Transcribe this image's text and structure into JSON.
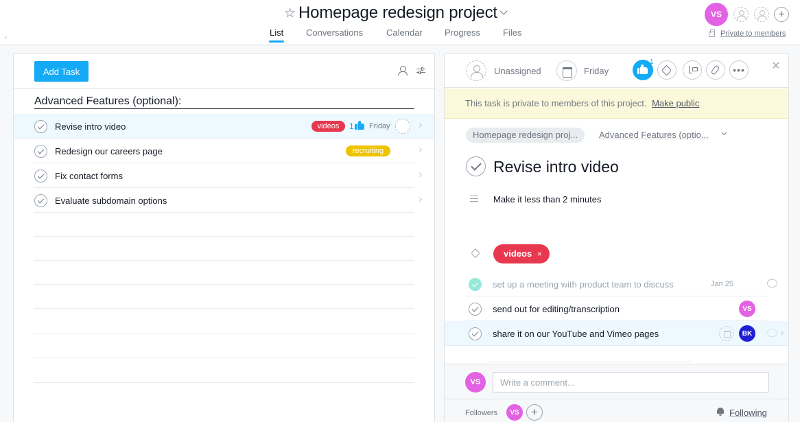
{
  "header": {
    "project_title": "Homepage redesign project",
    "tabs": [
      {
        "label": "List",
        "active": true
      },
      {
        "label": "Conversations",
        "active": false
      },
      {
        "label": "Calendar",
        "active": false
      },
      {
        "label": "Progress",
        "active": false
      },
      {
        "label": "Files",
        "active": false
      }
    ],
    "user_initials": "VS",
    "privacy_label": "Private to members",
    "collapse_glyph": "«",
    "plus_glyph": "+"
  },
  "list": {
    "add_task_label": "Add Task",
    "section_title": "Advanced Features (optional):",
    "tasks": [
      {
        "name": "Revise intro video",
        "tag": "videos",
        "tag_color": "#e8384f",
        "likes": "1",
        "due": "Friday",
        "selected": true
      },
      {
        "name": "Redesign our careers page",
        "tag": "recruiting",
        "tag_color": "#eec300"
      },
      {
        "name": "Fix contact forms"
      },
      {
        "name": "Evaluate subdomain options"
      }
    ]
  },
  "detail": {
    "assignee": "Unassigned",
    "due_date": "Friday",
    "like_count": "1",
    "close_glyph": "×",
    "more_glyph": "•••",
    "privacy_notice": "This task is private to members of this project.",
    "make_public_label": "Make public",
    "breadcrumb_project": "Homepage redesign proj...",
    "breadcrumb_section": "Advanced Features (optio...",
    "task_title": "Revise intro video",
    "description": "Make it less than 2 minutes",
    "tag": {
      "label": "videos",
      "remove_glyph": "×",
      "color": "#e8384f"
    },
    "subtasks": [
      {
        "text": "set up a meeting with product team to discuss",
        "date": "Jan 25",
        "completed": true
      },
      {
        "text": "send out for editing/transcription",
        "assignee": "VS"
      },
      {
        "text": "share it on our YouTube and Vimeo pages",
        "assignee": "BK",
        "selected": true
      }
    ],
    "comment_avatar": "VS",
    "comment_placeholder": "Write a comment...",
    "followers_label": "Followers",
    "follower_initials": "VS",
    "follower_plus_glyph": "+",
    "following_label": "Following"
  },
  "colors": {
    "accent": "#14aaf5",
    "avatar_vs": "#e362e3",
    "avatar_bk": "#1f1fd6",
    "banner_bg": "#fcf8dc",
    "done_green": "#5fddc5"
  }
}
